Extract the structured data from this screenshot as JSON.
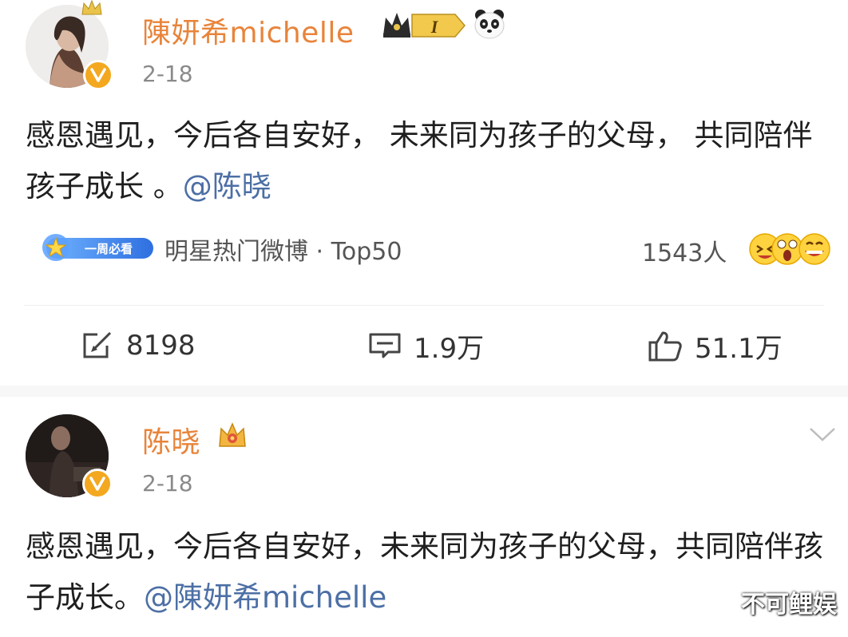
{
  "posts": [
    {
      "username": "陳妍希michelle",
      "date": "2-18",
      "content_text": "感恩遇见，今后各自安好， 未来同为孩子的父母， 共同陪伴孩子成长 。",
      "mention": "@陈晓",
      "topic": {
        "pill_label": "一周必看",
        "text": "明星热门微博 · Top50",
        "count": "1543人"
      },
      "actions": {
        "share": "8198",
        "comment": "1.9万",
        "like": "51.1万"
      },
      "badges": [
        "crown-icon",
        "level-badge-1",
        "panda-icon"
      ]
    },
    {
      "username": "陈晓",
      "date": "2-18",
      "content_text": "感恩遇见，今后各自安好，未来同为孩子的父母，共同陪伴孩子成长。",
      "mention": "@陳妍希michelle",
      "badges": [
        "crown-badge-icon"
      ]
    }
  ],
  "level_badge_text": "I",
  "watermark": "不可鲤娱",
  "colors": {
    "username": "#e8843a",
    "mention": "#4c6fa5",
    "verified": "#f3a81f"
  }
}
